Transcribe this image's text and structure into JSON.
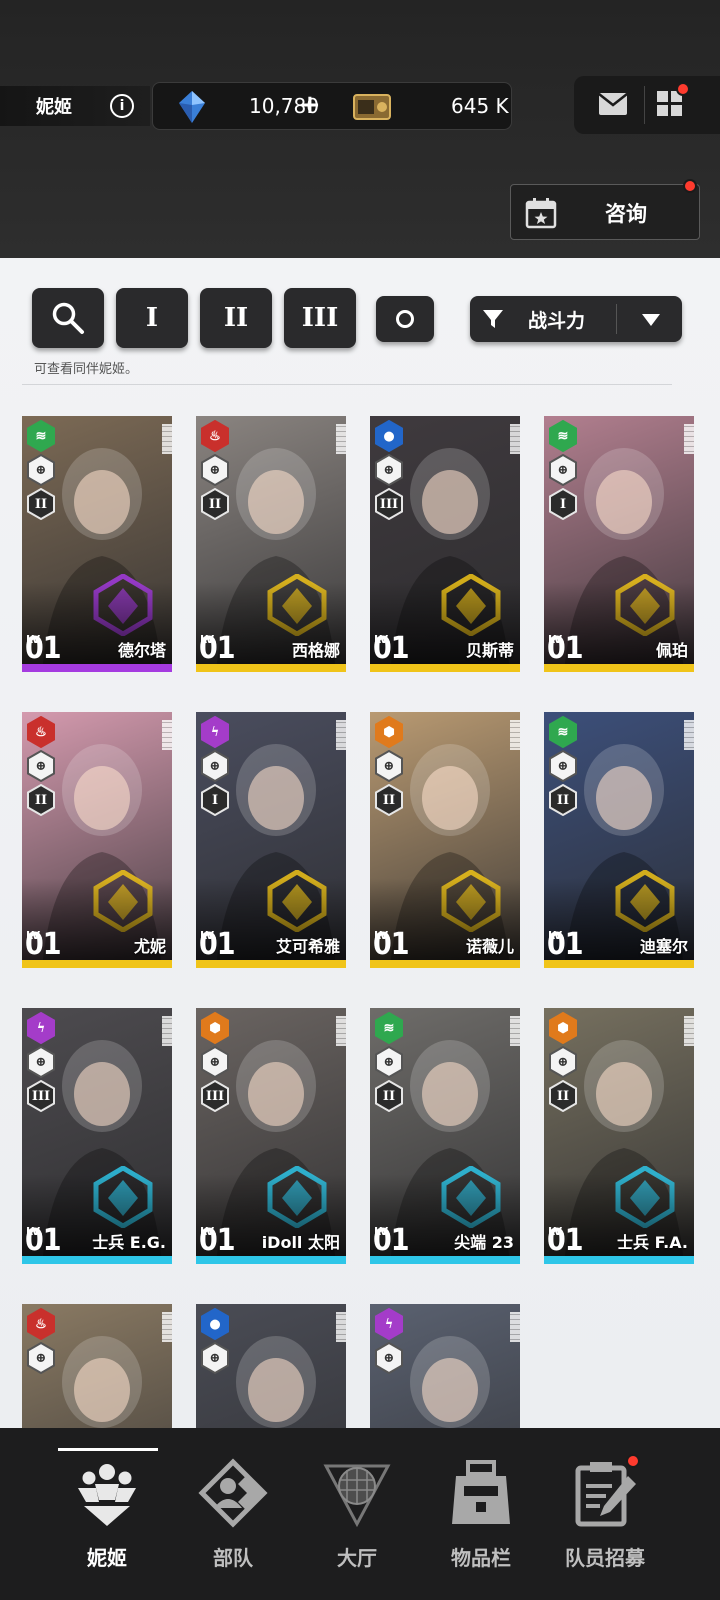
{
  "header": {
    "section_title": "妮姬",
    "gems": "10,780",
    "gems_plus": "+",
    "credits": "645 K",
    "consult_label": "咨询"
  },
  "filters": {
    "class_1": "I",
    "class_2": "II",
    "class_3": "III",
    "sort_label": "战斗力",
    "hint": "可查看同伴妮姬。"
  },
  "cards": [
    {
      "name": "德尔塔",
      "lv_label": "LV.",
      "level": "01",
      "element": "wind",
      "element_color": "#2fa84f",
      "burst": "II",
      "strip": "#a53be0",
      "bg": "#7c6a55"
    },
    {
      "name": "西格娜",
      "lv_label": "LV.",
      "level": "01",
      "element": "fire",
      "element_color": "#c9302c",
      "burst": "II",
      "strip": "#f0c419",
      "bg": "#8a8480"
    },
    {
      "name": "贝斯蒂",
      "lv_label": "LV.",
      "level": "01",
      "element": "water",
      "element_color": "#2266c9",
      "burst": "III",
      "strip": "#f0c419",
      "bg": "#3f3a3e"
    },
    {
      "name": "佩珀",
      "lv_label": "LV.",
      "level": "01",
      "element": "wind",
      "element_color": "#2fa84f",
      "burst": "I",
      "strip": "#f0c419",
      "bg": "#b27f8f"
    },
    {
      "name": "尤妮",
      "lv_label": "LV.",
      "level": "01",
      "element": "fire",
      "element_color": "#c9302c",
      "burst": "II",
      "strip": "#f0c419",
      "bg": "#d49aae"
    },
    {
      "name": "艾可希雅",
      "lv_label": "LV.",
      "level": "01",
      "element": "electric",
      "element_color": "#a43cc9",
      "burst": "I",
      "strip": "#f0c419",
      "bg": "#4a4d5e"
    },
    {
      "name": "诺薇儿",
      "lv_label": "LV.",
      "level": "01",
      "element": "iron",
      "element_color": "#e07a1c",
      "burst": "II",
      "strip": "#f0c419",
      "bg": "#b99a72"
    },
    {
      "name": "迪塞尔",
      "lv_label": "LV.",
      "level": "01",
      "element": "wind",
      "element_color": "#2fa84f",
      "burst": "II",
      "strip": "#f0c419",
      "bg": "#3c4f7a"
    },
    {
      "name": "士兵 E.G.",
      "lv_label": "LV.",
      "level": "01",
      "element": "electric",
      "element_color": "#a43cc9",
      "burst": "III",
      "strip": "#2ec6e8",
      "bg": "#4d4b4f"
    },
    {
      "name": "iDoll 太阳",
      "lv_label": "LV.",
      "level": "01",
      "element": "iron",
      "element_color": "#e07a1c",
      "burst": "III",
      "strip": "#2ec6e8",
      "bg": "#6a6461"
    },
    {
      "name": "尖端 23",
      "lv_label": "LV.",
      "level": "01",
      "element": "wind",
      "element_color": "#2fa84f",
      "burst": "II",
      "strip": "#2ec6e8",
      "bg": "#6e6c69"
    },
    {
      "name": "士兵 F.A.",
      "lv_label": "LV.",
      "level": "01",
      "element": "iron",
      "element_color": "#e07a1c",
      "burst": "II",
      "strip": "#2ec6e8",
      "bg": "#76705f"
    },
    {
      "name": "",
      "lv_label": "",
      "level": "",
      "element": "fire",
      "element_color": "#c9302c",
      "burst": "",
      "strip": "",
      "bg": "#8a7a63"
    },
    {
      "name": "",
      "lv_label": "",
      "level": "",
      "element": "water",
      "element_color": "#2266c9",
      "burst": "",
      "strip": "",
      "bg": "#4a4c55"
    },
    {
      "name": "",
      "lv_label": "",
      "level": "",
      "element": "electric",
      "element_color": "#a43cc9",
      "burst": "",
      "strip": "",
      "bg": "#5a6170"
    }
  ],
  "nav": [
    {
      "label": "妮姬",
      "icon": "nikke-group-icon",
      "active": true
    },
    {
      "label": "部队",
      "icon": "squad-icon",
      "active": false
    },
    {
      "label": "大厅",
      "icon": "lobby-icon",
      "active": false
    },
    {
      "label": "物品栏",
      "icon": "inventory-icon",
      "active": false
    },
    {
      "label": "队员招募",
      "icon": "recruit-icon",
      "active": false
    }
  ]
}
